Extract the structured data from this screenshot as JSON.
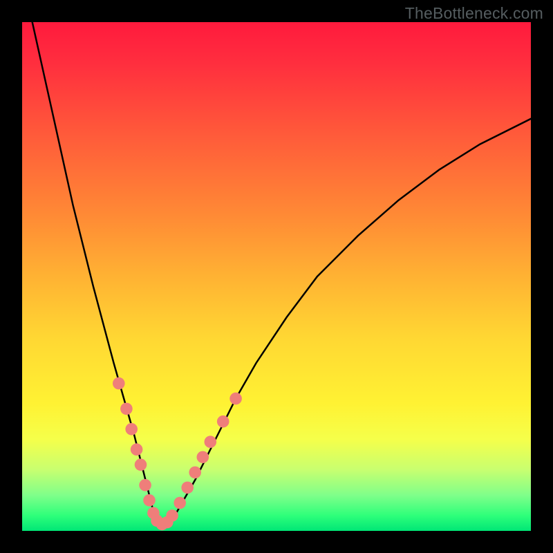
{
  "watermark": "TheBottleneck.com",
  "chart_data": {
    "type": "line",
    "title": "",
    "xlabel": "",
    "ylabel": "",
    "xlim": [
      0,
      100
    ],
    "ylim": [
      0,
      100
    ],
    "grid": false,
    "legend": false,
    "series": [
      {
        "name": "curve",
        "color": "#000000",
        "x": [
          2,
          6,
          10,
          14,
          18,
          20,
          22,
          23.5,
          25,
          26,
          27,
          28,
          30,
          34,
          38,
          42,
          46,
          52,
          58,
          66,
          74,
          82,
          90,
          100
        ],
        "y": [
          100,
          82,
          64,
          48,
          33,
          26,
          19,
          13,
          7,
          3,
          1,
          1,
          3,
          10,
          18,
          26,
          33,
          42,
          50,
          58,
          65,
          71,
          76,
          81
        ]
      }
    ],
    "markers": {
      "color": "#ef7e7a",
      "radius_pct": 1.2,
      "points": [
        {
          "x": 19.0,
          "y": 29.0
        },
        {
          "x": 20.5,
          "y": 24.0
        },
        {
          "x": 21.5,
          "y": 20.0
        },
        {
          "x": 22.5,
          "y": 16.0
        },
        {
          "x": 23.3,
          "y": 13.0
        },
        {
          "x": 24.2,
          "y": 9.0
        },
        {
          "x": 25.0,
          "y": 6.0
        },
        {
          "x": 25.8,
          "y": 3.5
        },
        {
          "x": 26.5,
          "y": 2.0
        },
        {
          "x": 27.5,
          "y": 1.3
        },
        {
          "x": 28.5,
          "y": 1.7
        },
        {
          "x": 29.5,
          "y": 3.0
        },
        {
          "x": 31.0,
          "y": 5.5
        },
        {
          "x": 32.5,
          "y": 8.5
        },
        {
          "x": 34.0,
          "y": 11.5
        },
        {
          "x": 35.5,
          "y": 14.5
        },
        {
          "x": 37.0,
          "y": 17.5
        },
        {
          "x": 39.5,
          "y": 21.5
        },
        {
          "x": 42.0,
          "y": 26.0
        }
      ]
    }
  }
}
